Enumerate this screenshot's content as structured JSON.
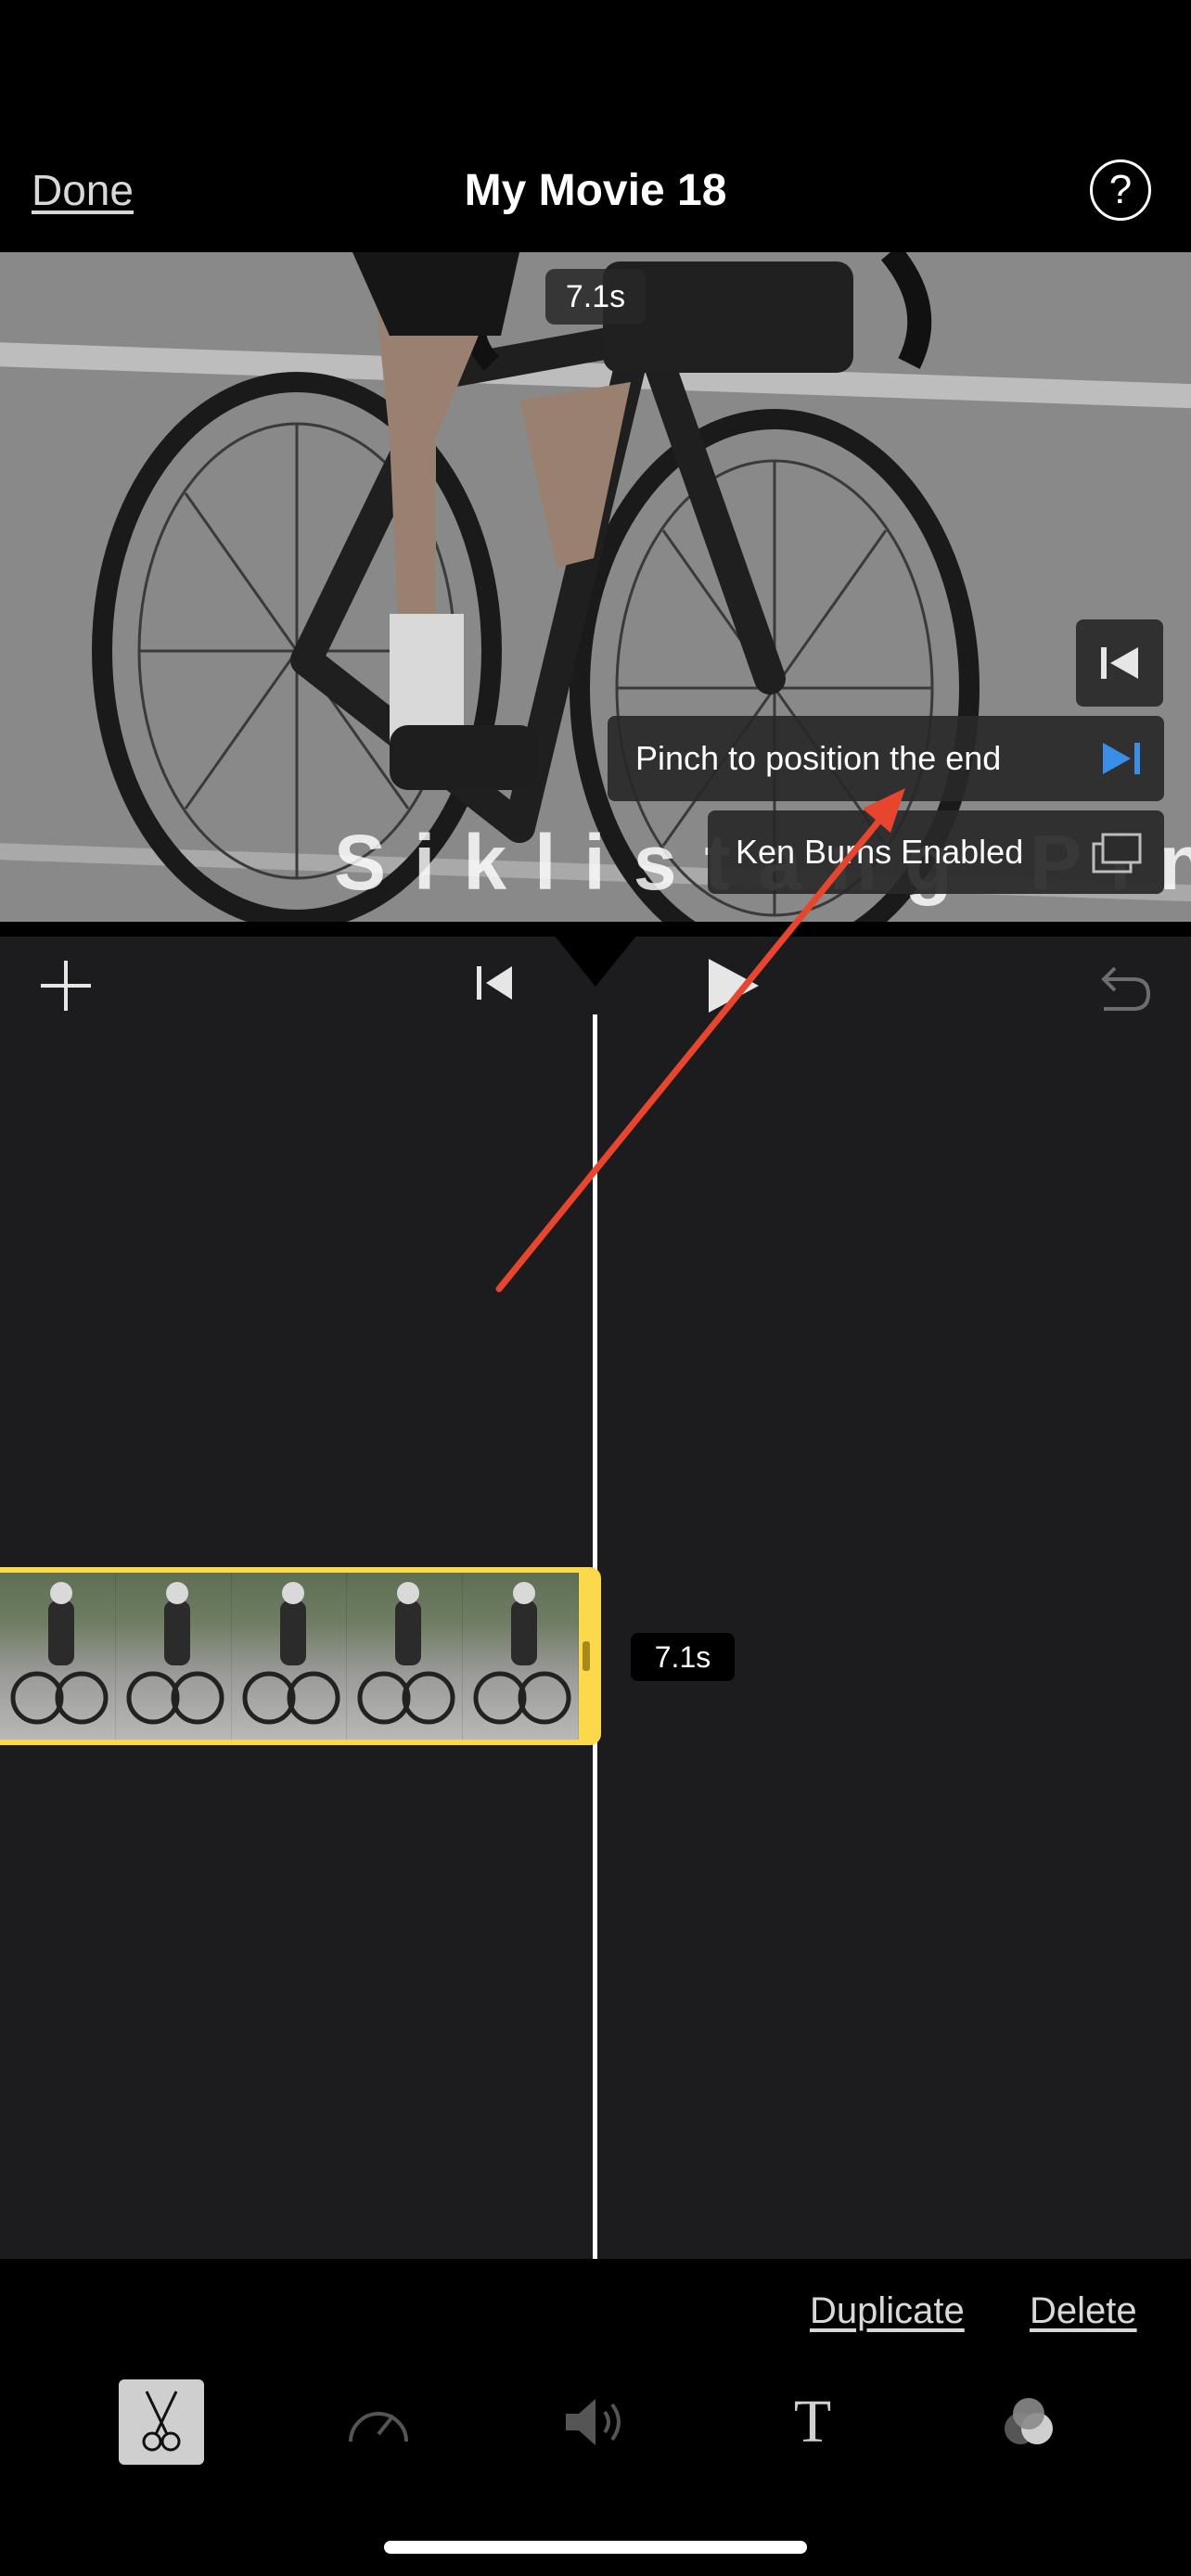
{
  "nav": {
    "done_label": "Done",
    "title": "My Movie 18",
    "help_symbol": "?"
  },
  "viewer": {
    "duration_badge": "7.1s",
    "watermark_text": "Siklistang Pinoy",
    "hint_text": "Pinch to position the end",
    "ken_burns_label": "Ken Burns Enabled"
  },
  "timeline": {
    "clip_duration": "7.1s",
    "clip_frame_count": 5
  },
  "actions": {
    "duplicate_label": "Duplicate",
    "delete_label": "Delete"
  },
  "toolbar": {
    "tools": [
      "scissors-icon",
      "speed-gauge-icon",
      "volume-icon",
      "title-text-icon",
      "filters-icon"
    ],
    "active_tool": "scissors-icon",
    "text_tool_glyph": "T"
  },
  "colors": {
    "clip_border": "#fcd94a",
    "annotation_arrow": "#e8452e",
    "accent_blue": "#3a8ee6",
    "timeline_bg": "#1c1c1e"
  }
}
